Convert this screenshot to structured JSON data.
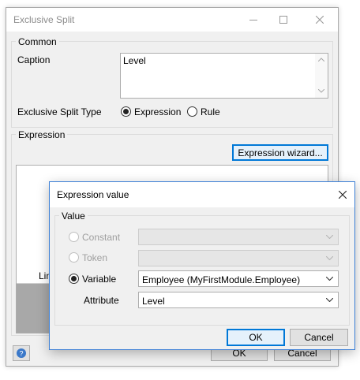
{
  "back_window": {
    "title": "Exclusive Split",
    "common_group": "Common",
    "caption_label": "Caption",
    "caption_value": "Level",
    "split_type_label": "Exclusive Split Type",
    "split_type_options": [
      "Expression",
      "Rule"
    ],
    "split_type_selected": "Expression",
    "expression_group": "Expression",
    "expression_wizard_button": "Expression wizard...",
    "table_header_partial": "Lin",
    "ok_button": "OK",
    "cancel_button": "Cancel",
    "help_icon": "help-icon"
  },
  "front_dialog": {
    "title": "Expression value",
    "value_group": "Value",
    "options": [
      {
        "label": "Constant",
        "enabled": false,
        "selected": false,
        "combo_value": ""
      },
      {
        "label": "Token",
        "enabled": false,
        "selected": false,
        "combo_value": ""
      },
      {
        "label": "Variable",
        "enabled": true,
        "selected": true,
        "combo_value": "Employee (MyFirstModule.Employee)"
      }
    ],
    "attribute_label": "Attribute",
    "attribute_value": "Level",
    "ok_button": "OK",
    "cancel_button": "Cancel"
  },
  "colors": {
    "accent": "#0078d7",
    "window_bg": "#f0f0f0",
    "disabled_text": "#9f9f9f"
  }
}
